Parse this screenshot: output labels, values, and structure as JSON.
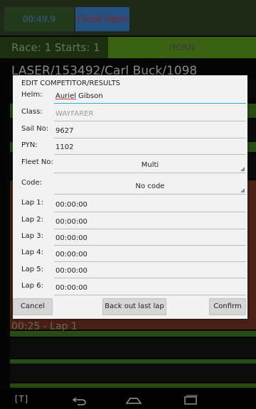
{
  "app": {
    "timer": "00:49.9",
    "finish_button": "Finish Open",
    "race_label": "Race: 1 Starts: 1",
    "horn_button": "HORN",
    "competitor_header": "LASER/153492/Carl Buck/1098",
    "lap_text": "00:25 - Lap 1"
  },
  "dialog": {
    "title": "EDIT COMPETITOR/RESULTS",
    "helm": {
      "label": "Helm:",
      "first": "Auriel",
      "rest": " Gibson"
    },
    "class": {
      "label": "Class:",
      "value": "WAYFARER"
    },
    "sail_no": {
      "label": "Sail No:",
      "value": "9627"
    },
    "pyn": {
      "label": "PYN:",
      "value": "1102"
    },
    "fleet_no": {
      "label": "Fleet No:",
      "value": "Multi"
    },
    "code": {
      "label": "Code:",
      "value": "No code"
    },
    "laps": [
      {
        "label": "Lap 1:",
        "value": "00:00:00"
      },
      {
        "label": "Lap 2:",
        "value": "00:00:00"
      },
      {
        "label": "Lap 3:",
        "value": "00:00:00"
      },
      {
        "label": "Lap 4:",
        "value": "00:00:00"
      },
      {
        "label": "Lap 5:",
        "value": "00:00:00"
      },
      {
        "label": "Lap 6:",
        "value": "00:00:00"
      }
    ],
    "buttons": {
      "cancel": "Cancel",
      "back_out": "Back out last lap",
      "confirm": "Confirm"
    }
  },
  "navbar": {
    "keyboard_label": "[T]",
    "back_icon": "back-arrow-icon",
    "home_icon": "home-icon",
    "recents_icon": "recents-icon"
  },
  "colors": {
    "accent": "#3aa0d8",
    "dialog_bg": "#f2f2f2",
    "horn_green": "#3b6113"
  }
}
